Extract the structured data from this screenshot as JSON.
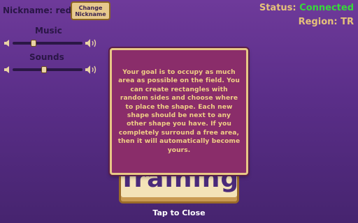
{
  "header": {
    "nickname_label": "Nickname: red",
    "change_nickname_label": "Change\nNickname",
    "status_label": "Status:",
    "status_value": "Connected",
    "region_label": "Region: TR"
  },
  "audio": {
    "music_label": "Music",
    "music_level": 0.3,
    "sounds_label": "Sounds",
    "sounds_level": 0.45
  },
  "mode_button_label": "Training",
  "modal": {
    "text": "Your goal is to occupy as much area as possible on the field. You can create rectangles with random sides and choose where to place the shape. Each new shape should be next to any other shape you have. If you completely surround a free area, then it will automatically become yours."
  },
  "close_hint": "Tap to Close",
  "colors": {
    "status_connected": "#37d83a",
    "accent_gold": "#e6c27a",
    "modal_bg": "#8a2d6a"
  }
}
